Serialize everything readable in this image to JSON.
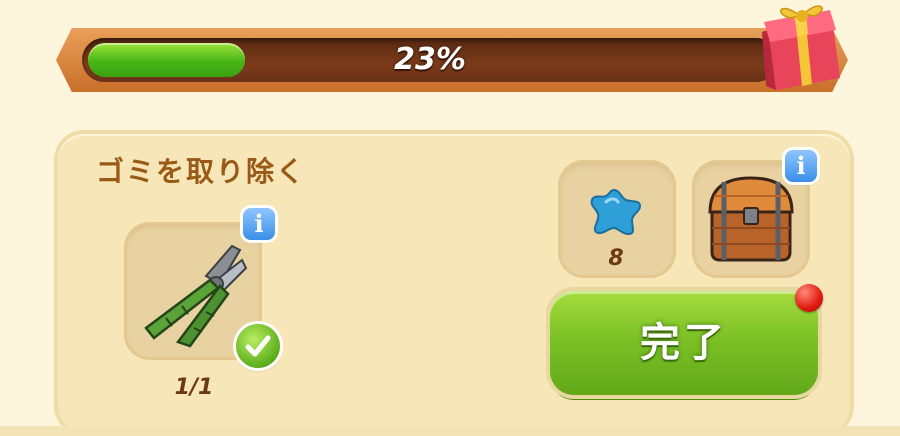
{
  "progress": {
    "percent_label": "23%",
    "value": 0.23
  },
  "task": {
    "title": "ゴミを取り除く",
    "requirement": {
      "item_icon": "pliers-icon",
      "count": "1/1",
      "completed": true
    }
  },
  "rewards": [
    {
      "icon": "blue-star-gem-icon",
      "count": "8"
    },
    {
      "icon": "treasure-chest-icon",
      "count": ""
    }
  ],
  "complete_button": {
    "label": "完了",
    "has_notification": true
  },
  "colors": {
    "progress_fill": "#47b617",
    "button_green": "#7cc226",
    "panel_bg": "#f6e6b8",
    "title_brown": "#9a5a17",
    "notification_red": "#e01a10"
  }
}
